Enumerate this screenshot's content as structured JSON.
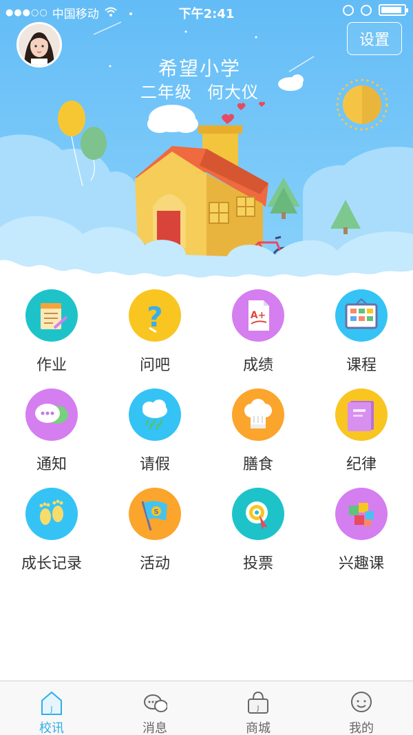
{
  "status_bar": {
    "carrier": "中国移动",
    "time": "下午2:41",
    "battery_level": 0.9
  },
  "header": {
    "settings_label": "设置",
    "school_name": "希望小学",
    "grade": "二年级",
    "student_name": "何大仪"
  },
  "colors": {
    "sky": "#6ec1f7",
    "accent": "#2eaee9"
  },
  "grid": [
    {
      "label": "作业",
      "icon": "homework-icon",
      "color": "#1ec3c9"
    },
    {
      "label": "问吧",
      "icon": "question-icon",
      "color": "#f9c521"
    },
    {
      "label": "成绩",
      "icon": "grade-paper-icon",
      "color": "#d57ef0"
    },
    {
      "label": "课程",
      "icon": "schedule-board-icon",
      "color": "#35c3f5"
    },
    {
      "label": "通知",
      "icon": "chat-bubble-icon",
      "color": "#d57ef0"
    },
    {
      "label": "请假",
      "icon": "rain-cloud-icon",
      "color": "#35c3f5"
    },
    {
      "label": "膳食",
      "icon": "chef-hat-icon",
      "color": "#fba52c"
    },
    {
      "label": "纪律",
      "icon": "book-icon",
      "color": "#f9c521"
    },
    {
      "label": "成长记录",
      "icon": "footprints-icon",
      "color": "#35c3f5"
    },
    {
      "label": "活动",
      "icon": "flag-icon",
      "color": "#fba52c"
    },
    {
      "label": "投票",
      "icon": "target-icon",
      "color": "#1ec3c9"
    },
    {
      "label": "兴趣课",
      "icon": "puzzle-icon",
      "color": "#d57ef0"
    }
  ],
  "tabs": [
    {
      "label": "校讯",
      "icon": "school-house-icon",
      "active": true
    },
    {
      "label": "消息",
      "icon": "message-icon",
      "active": false
    },
    {
      "label": "商城",
      "icon": "shop-bag-icon",
      "active": false
    },
    {
      "label": "我的",
      "icon": "profile-face-icon",
      "active": false
    }
  ]
}
